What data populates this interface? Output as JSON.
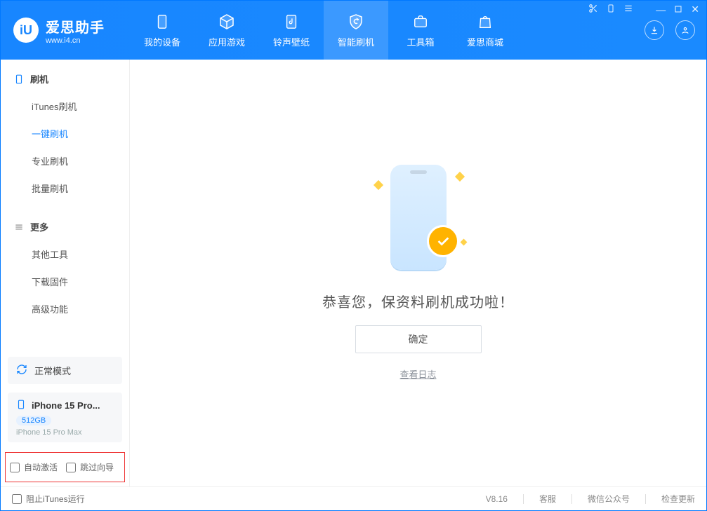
{
  "app": {
    "title": "爱思助手",
    "subtitle": "www.i4.cn",
    "version": "V8.16"
  },
  "nav": {
    "items": [
      {
        "label": "我的设备"
      },
      {
        "label": "应用游戏"
      },
      {
        "label": "铃声壁纸"
      },
      {
        "label": "智能刷机"
      },
      {
        "label": "工具箱"
      },
      {
        "label": "爱思商城"
      }
    ]
  },
  "sidebar": {
    "groups": [
      {
        "header": "刷机",
        "items": [
          "iTunes刷机",
          "一键刷机",
          "专业刷机",
          "批量刷机"
        ],
        "active_index": 1
      },
      {
        "header": "更多",
        "items": [
          "其他工具",
          "下载固件",
          "高级功能"
        ]
      }
    ],
    "mode_label": "正常模式",
    "device": {
      "name": "iPhone 15 Pro...",
      "capacity": "512GB",
      "model": "iPhone 15 Pro Max"
    },
    "checkboxes": {
      "auto_activate": "自动激活",
      "skip_wizard": "跳过向导"
    }
  },
  "main": {
    "title": "恭喜您，保资料刷机成功啦！",
    "ok_label": "确定",
    "view_log_label": "查看日志"
  },
  "footer": {
    "block_itunes_label": "阻止iTunes运行",
    "links": {
      "support": "客服",
      "wechat": "微信公众号",
      "updates": "检查更新"
    }
  }
}
